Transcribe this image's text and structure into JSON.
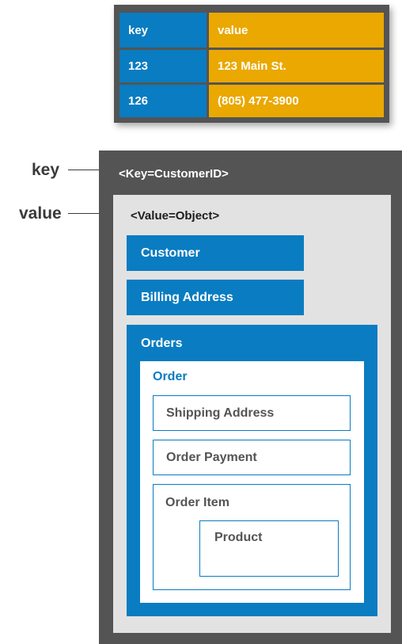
{
  "table": {
    "header": {
      "key": "key",
      "value": "value"
    },
    "rows": [
      {
        "key": "123",
        "value": "123 Main St."
      },
      {
        "key": "126",
        "value": "(805) 477-3900"
      }
    ]
  },
  "labels": {
    "key": "key",
    "value": "value"
  },
  "document": {
    "key_text": "<Key=CustomerID>",
    "value_text": "<Value=Object>",
    "customer": "Customer",
    "billing_address": "Billing Address",
    "orders": "Orders",
    "order": "Order",
    "shipping_address": "Shipping Address",
    "order_payment": "Order Payment",
    "order_item": "Order Item",
    "product": "Product"
  },
  "colors": {
    "blue": "#0a7cc1",
    "amber": "#eaa800",
    "dark_gray": "#545454",
    "light_gray": "#e2e2e2"
  }
}
